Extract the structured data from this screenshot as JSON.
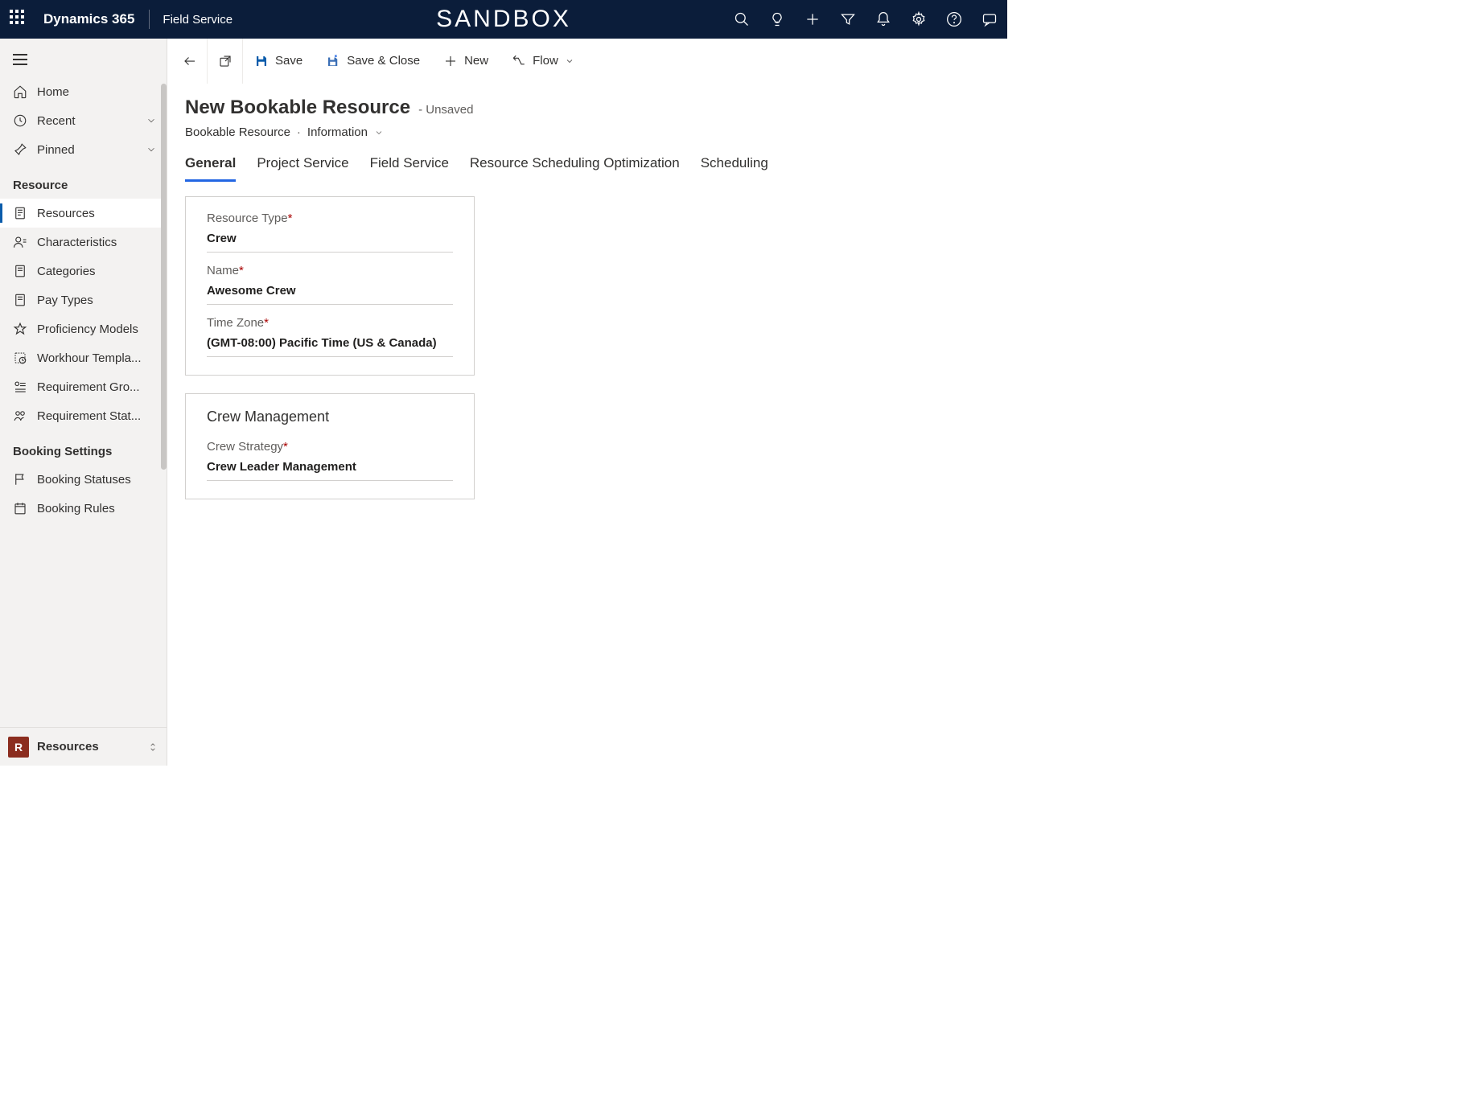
{
  "topbar": {
    "brand": "Dynamics 365",
    "area": "Field Service",
    "center": "SANDBOX"
  },
  "sidebar": {
    "home": "Home",
    "recent": "Recent",
    "pinned": "Pinned",
    "group_resource": "Resource",
    "items_resource": [
      "Resources",
      "Characteristics",
      "Categories",
      "Pay Types",
      "Proficiency Models",
      "Workhour Templa...",
      "Requirement Gro...",
      "Requirement Stat..."
    ],
    "group_booking": "Booking Settings",
    "items_booking": [
      "Booking Statuses",
      "Booking Rules"
    ],
    "area_switcher": {
      "badge": "R",
      "label": "Resources"
    }
  },
  "commands": {
    "save": "Save",
    "save_close": "Save & Close",
    "new": "New",
    "flow": "Flow"
  },
  "record": {
    "title": "New Bookable Resource",
    "state": "- Unsaved",
    "entity": "Bookable Resource",
    "form": "Information"
  },
  "tabs": [
    "General",
    "Project Service",
    "Field Service",
    "Resource Scheduling Optimization",
    "Scheduling"
  ],
  "form": {
    "resource_type_label": "Resource Type",
    "resource_type_value": "Crew",
    "name_label": "Name",
    "name_value": "Awesome Crew",
    "timezone_label": "Time Zone",
    "timezone_value": "(GMT-08:00) Pacific Time (US & Canada)",
    "section2_title": "Crew Management",
    "crew_strategy_label": "Crew Strategy",
    "crew_strategy_value": "Crew Leader Management"
  }
}
